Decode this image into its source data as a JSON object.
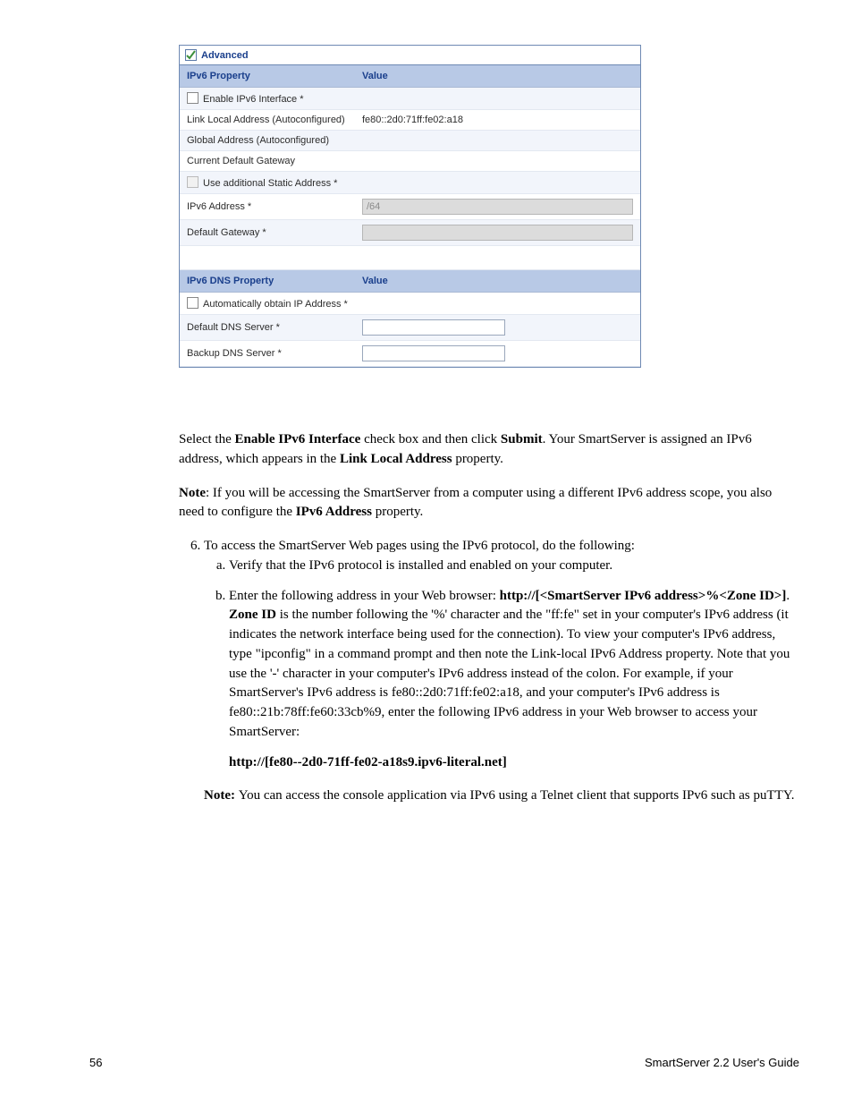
{
  "panel": {
    "title": "Advanced"
  },
  "table1": {
    "col1": "IPv6 Property",
    "col2": "Value",
    "rows": {
      "enable_ipv6": "Enable IPv6 Interface *",
      "link_local": "Link Local Address (Autoconfigured)",
      "link_local_val": "fe80::2d0:71ff:fe02:a18",
      "global_addr": "Global Address (Autoconfigured)",
      "cur_gateway": "Current Default Gateway",
      "use_static": "Use additional Static Address *",
      "ipv6_addr": "IPv6 Address *",
      "ipv6_addr_val": "/64",
      "def_gateway": "Default Gateway *"
    }
  },
  "table2": {
    "col1": "IPv6 DNS Property",
    "col2": "Value",
    "rows": {
      "auto_ip": "Automatically obtain IP Address *",
      "def_dns": "Default DNS Server *",
      "bak_dns": "Backup DNS Server *"
    }
  },
  "body": {
    "p1_a": "Select the ",
    "p1_b": "Enable IPv6 Interface",
    "p1_c": " check box and then click ",
    "p1_d": "Submit",
    "p1_e": ". Your SmartServer is assigned an IPv6 address, which appears in the ",
    "p1_f": "Link Local Address",
    "p1_g": " property.",
    "note_a": "Note",
    "note_b": ": If you will be accessing the SmartServer from a computer using a different IPv6 address scope, you also need to configure the ",
    "note_c": "IPv6 Address",
    "note_d": " property.",
    "li_a": "To access the SmartServer Web pages using the IPv6 protocol, do the following:",
    "sub_a_1": "Verify that the IPv6 protocol is installed and enabled on your computer.",
    "sub_b_1": "Enter the following address in your Web browser: ",
    "sub_b_2": "http://[<SmartServer IPv6 address>%<Zone ID>]",
    "sub_b_3": ". ",
    "sub_b_4": "Zone ID",
    "sub_b_5": " is the number following the '%' character and the \"ff:fe\" set in your computer's IPv6 address (it indicates the network interface being used for the connection). To view your computer's IPv6 address, type \"ipconfig\" in a command prompt and then note the Link-local IPv6 Address property. Note that you use the '-' character in your computer's IPv6 address instead of the colon.  For example, if your SmartServer's IPv6 address is fe80::2d0:71ff:fe02:a18, and your computer's IPv6 address is fe80::21b:78ff:fe60:33cb%9, enter the following IPv6 address in your Web browser to access your SmartServer:",
    "sub_b_addr": "http://[fe80--2d0-71ff-fe02-a18s9.ipv6-literal.net]",
    "note2_a": "Note: ",
    "note2_b": "You can access the console application via IPv6 using a Telnet client that supports IPv6 such as puTTY."
  },
  "footer": {
    "left": "56",
    "right": "SmartServer 2.2 User's Guide"
  }
}
